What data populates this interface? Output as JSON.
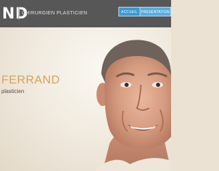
{
  "header": {
    "brand": "ND",
    "tagline": "CHIRURGIEN PLASTICIEN",
    "nav": [
      {
        "label": "ACCUEIL"
      },
      {
        "label": "PRESENTATION"
      }
    ]
  },
  "hero": {
    "name": "FERRAND",
    "role": "plasticien"
  },
  "colors": {
    "header_bg": "#575757",
    "nav_accent": "#3a9ad4",
    "name_gold": "#d6a25a"
  }
}
